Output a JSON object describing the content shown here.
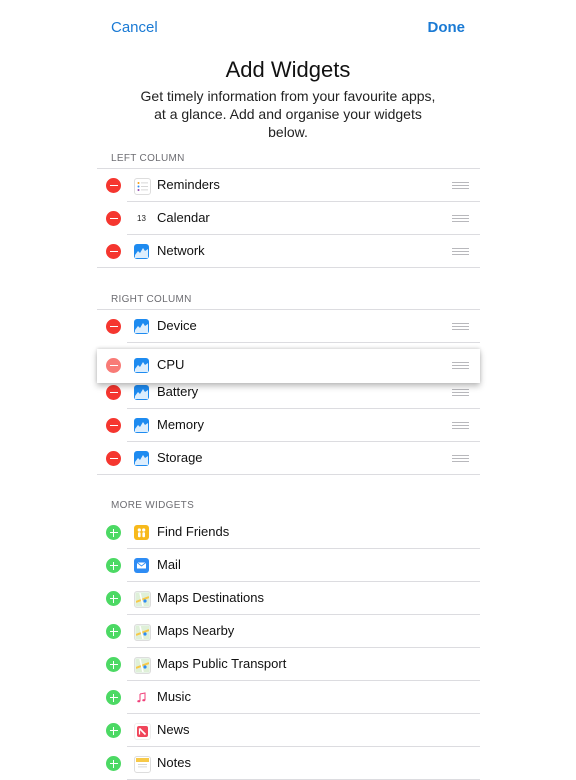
{
  "nav": {
    "cancel_label": "Cancel",
    "done_label": "Done"
  },
  "header": {
    "title": "Add Widgets",
    "subtitle": "Get timely information from your favourite apps, at a glance. Add and organise your widgets below."
  },
  "sections": {
    "left": {
      "header": "LEFT COLUMN",
      "items": [
        {
          "label": "Reminders",
          "icon": "reminders-icon"
        },
        {
          "label": "Calendar",
          "icon": "calendar-icon",
          "icon_text": "13"
        },
        {
          "label": "Network",
          "icon": "stats-icon"
        }
      ]
    },
    "right": {
      "header": "RIGHT COLUMN",
      "items": [
        {
          "label": "Device",
          "icon": "stats-icon"
        },
        {
          "label": "CPU",
          "icon": "stats-icon",
          "state": "dragging"
        },
        {
          "label": "Battery",
          "icon": "stats-icon"
        },
        {
          "label": "Memory",
          "icon": "stats-icon"
        },
        {
          "label": "Storage",
          "icon": "stats-icon"
        }
      ]
    },
    "more": {
      "header": "MORE WIDGETS",
      "items": [
        {
          "label": "Find Friends",
          "icon": "find-friends-icon"
        },
        {
          "label": "Mail",
          "icon": "mail-icon"
        },
        {
          "label": "Maps Destinations",
          "icon": "maps-icon"
        },
        {
          "label": "Maps Nearby",
          "icon": "maps-icon"
        },
        {
          "label": "Maps Public Transport",
          "icon": "maps-icon"
        },
        {
          "label": "Music",
          "icon": "music-icon"
        },
        {
          "label": "News",
          "icon": "news-icon"
        },
        {
          "label": "Notes",
          "icon": "notes-icon"
        }
      ]
    }
  },
  "colors": {
    "accent": "#1a7ad4",
    "remove": "#f5362f",
    "add": "#4cd964"
  }
}
